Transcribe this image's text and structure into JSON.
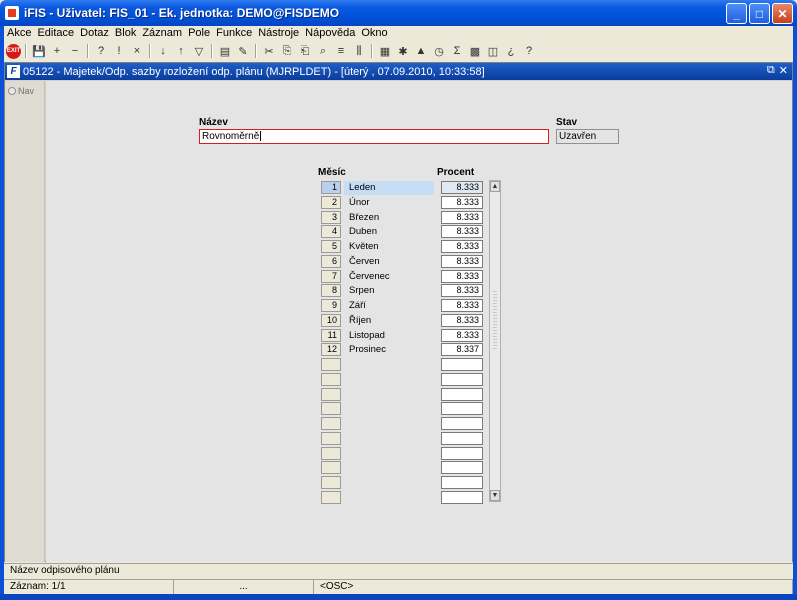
{
  "window": {
    "title": "iFIS - Uživatel: FIS_01 - Ek. jednotka: DEMO@FISDEMO",
    "minimize": "_",
    "maximize": "□",
    "close": "✕"
  },
  "menu": [
    "Akce",
    "Editace",
    "Dotaz",
    "Blok",
    "Záznam",
    "Pole",
    "Funkce",
    "Nástroje",
    "Nápověda",
    "Okno"
  ],
  "toolbar": {
    "exit_label": "EXIT",
    "icons": [
      "save-icon",
      "print-icon",
      "find-icon",
      "sigma-icon",
      "excel-icon",
      "help-icon"
    ]
  },
  "form": {
    "title": "05122 - Majetek/Odp. sazby rozložení odp. plánu (MJRPLDET) - [úterý  , 07.09.2010, 10:33:58]",
    "nav_label": "Nav",
    "nazev_label": "Název",
    "nazev_value": "Rovnoměrně",
    "stav_label": "Stav",
    "stav_value": "Uzavřen",
    "mesic_header": "Měsíc",
    "procent_header": "Procent",
    "rows": [
      {
        "num": "1",
        "mesic": "Leden",
        "procent": "8.333"
      },
      {
        "num": "2",
        "mesic": "Únor",
        "procent": "8.333"
      },
      {
        "num": "3",
        "mesic": "Březen",
        "procent": "8.333"
      },
      {
        "num": "4",
        "mesic": "Duben",
        "procent": "8.333"
      },
      {
        "num": "5",
        "mesic": "Květen",
        "procent": "8.333"
      },
      {
        "num": "6",
        "mesic": "Červen",
        "procent": "8.333"
      },
      {
        "num": "7",
        "mesic": "Červenec",
        "procent": "8.333"
      },
      {
        "num": "8",
        "mesic": "Srpen",
        "procent": "8.333"
      },
      {
        "num": "9",
        "mesic": "Září",
        "procent": "8.333"
      },
      {
        "num": "10",
        "mesic": "Říjen",
        "procent": "8.333"
      },
      {
        "num": "11",
        "mesic": "Listopad",
        "procent": "8.333"
      },
      {
        "num": "12",
        "mesic": "Prosinec",
        "procent": "8.337"
      }
    ],
    "empty_rows": 10
  },
  "status": {
    "hint": "Název odpisového plánu",
    "record": "Záznam: 1/1",
    "ellipsis": "...",
    "mode": "<OSC>"
  }
}
